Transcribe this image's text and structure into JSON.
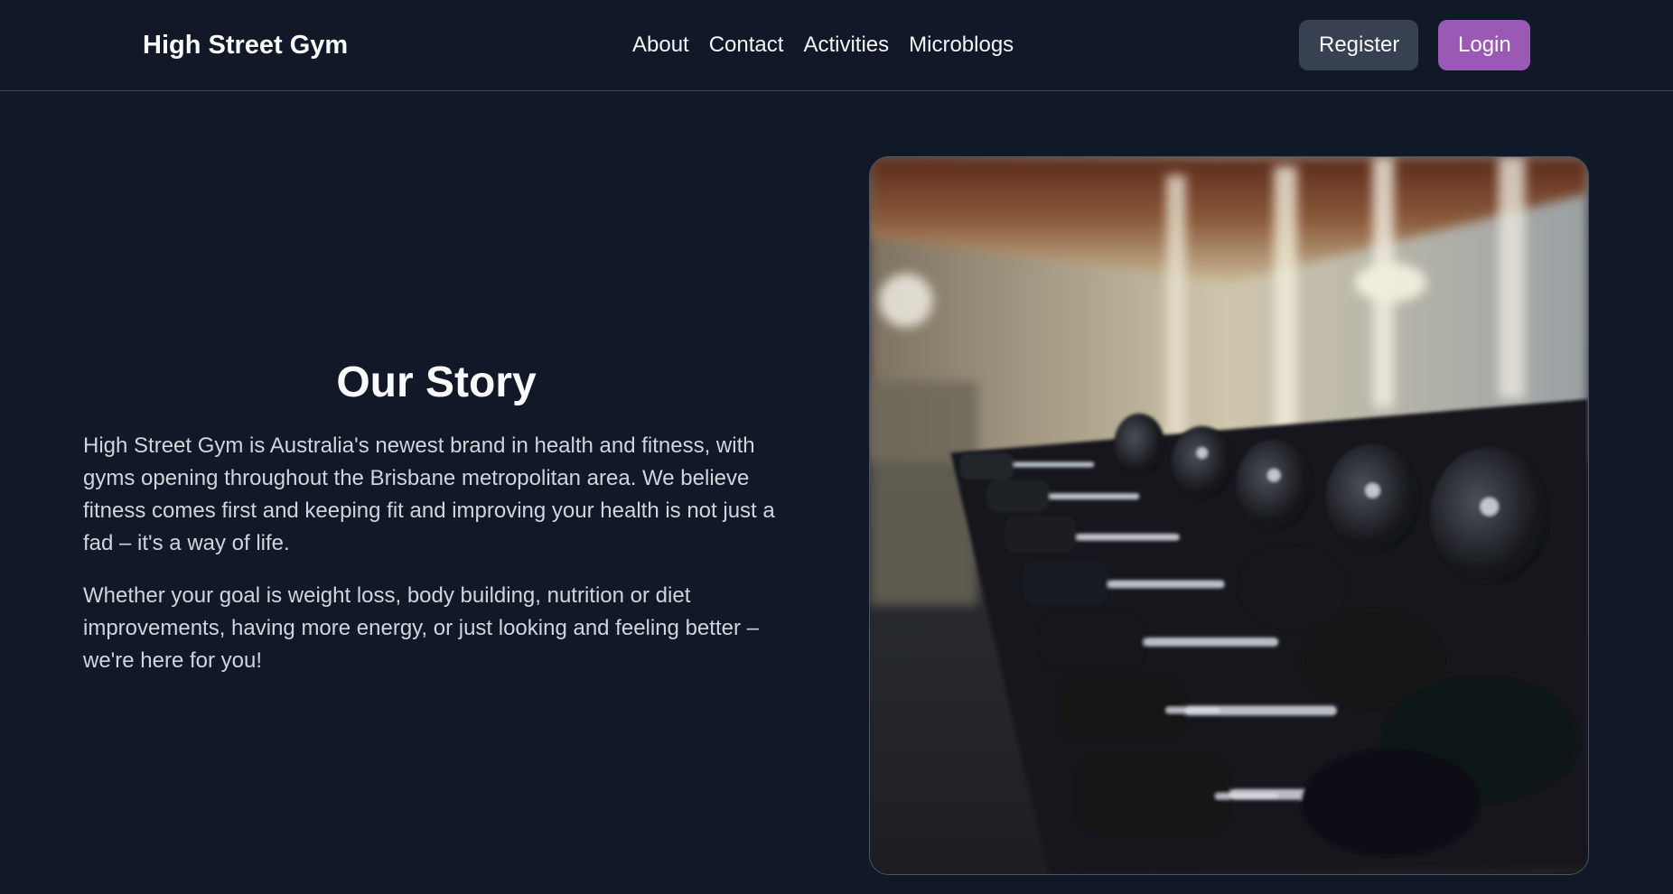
{
  "nav": {
    "brand": "High Street Gym",
    "links": [
      "About",
      "Contact",
      "Activities",
      "Microblogs"
    ],
    "register_label": "Register",
    "login_label": "Login"
  },
  "story": {
    "title": "Our Story",
    "paragraphs": [
      "High Street Gym is Australia's newest brand in health and fitness, with gyms opening throughout the Brisbane metropolitan area. We believe fitness comes first and keeping fit and improving your health is not just a fad – it's a way of life.",
      "Whether your goal is weight loss, body building, nutrition or diet improvements, having more energy, or just looking and feeling better – we're here for you!"
    ]
  },
  "colors": {
    "background": "#111827",
    "register_button": "#374151",
    "login_button": "#9b59b6"
  }
}
